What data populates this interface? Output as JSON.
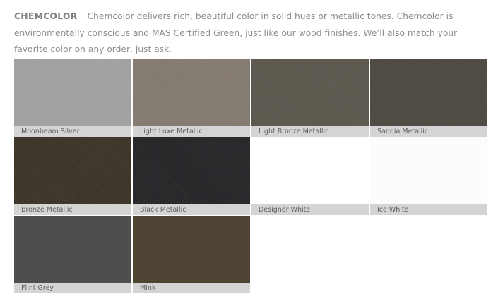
{
  "intro": {
    "brand": "CHEMCOLOR",
    "text": "Chemcolor delivers rich, beautiful color in solid hues or metallic tones. Chemcolor is environmentally conscious and MAS Certified Green, just like our wood finishes. We’ll also match your favorite color on any order, just ask."
  },
  "swatches": [
    {
      "label": "Moonbeam Silver",
      "color": "#a3a3a3",
      "textured": true
    },
    {
      "label": "Light Luxe Metallic",
      "color": "#857b71",
      "textured": true
    },
    {
      "label": "Light Bronze Metallic",
      "color": "#5e594f",
      "textured": true
    },
    {
      "label": "Sandia Metallic",
      "color": "#4f4b43",
      "textured": true
    },
    {
      "label": "Bronze Metallic",
      "color": "#3e3529",
      "textured": true
    },
    {
      "label": "Black Metallic",
      "color": "#27272a",
      "textured": true
    },
    {
      "label": "Designer White",
      "color": "#ffffff",
      "textured": false
    },
    {
      "label": "Ice White",
      "color": "#fcfbfd",
      "textured": false
    },
    {
      "label": "Flint Grey",
      "color": "#4e4e4e",
      "textured": false
    },
    {
      "label": "Mink",
      "color": "#4f4334",
      "textured": false
    }
  ]
}
